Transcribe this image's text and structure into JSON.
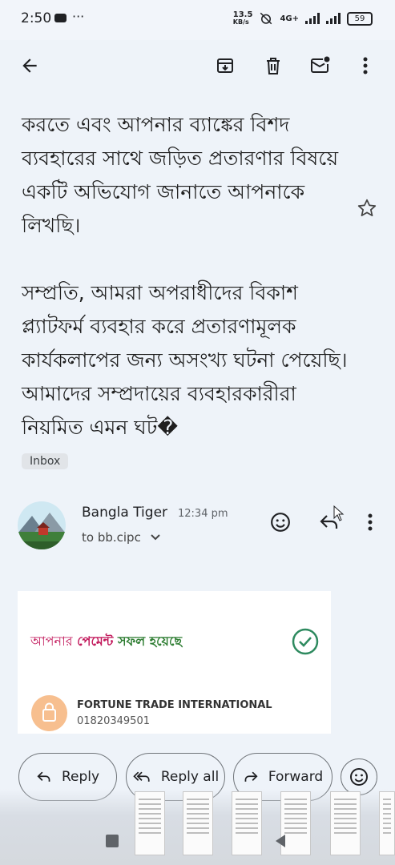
{
  "status": {
    "time": "2:50",
    "net_speed_top": "13.5",
    "net_speed_unit": "KB/s",
    "network": "4G+",
    "battery": "59"
  },
  "body": {
    "paragraph1": "করতে এবং আপনার ব্যাঙ্কের বিশদ ব্যবহারের সাথে জড়িত প্রতারণার বিষয়ে একটি অভিযোগ জানাতে আপনাকে লিখছি।",
    "paragraph2": "সম্প্রতি, আমরা অপরাধীদের বিকাশ প্ল্যাটফর্ম ব্যবহার করে প্রতারণামূলক কার্যকলাপের জন্য অসংখ্য ঘটনা পেয়েছি। আমাদের সম্প্রদায়ের ব্যবহারকারীরা নিয়মিত এমন ঘট�"
  },
  "label": "Inbox",
  "message": {
    "sender": "Bangla Tiger",
    "time": "12:34 pm",
    "to": "to bb.cipc"
  },
  "card": {
    "title_part1": "আপনার",
    "title_part2": "পেমেন্ট",
    "title_part3": "সফল হয়েছে",
    "business": "FORTUNE TRADE INTERNATIONAL",
    "phone": "01820349501"
  },
  "actions": {
    "reply": "Reply",
    "reply_all": "Reply all",
    "forward": "Forward"
  },
  "colors": {
    "background": "#eef3f9",
    "pink": "#c2185b",
    "green": "#2e7d32",
    "check": "#2e8a5f"
  }
}
